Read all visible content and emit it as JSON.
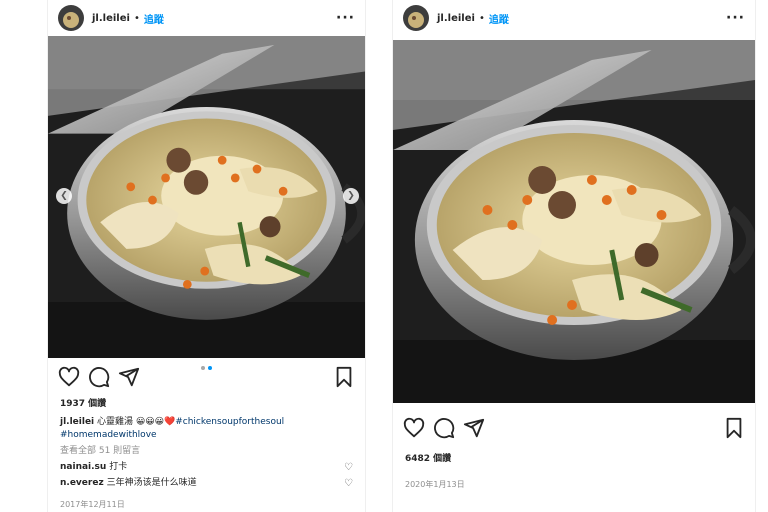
{
  "left_post": {
    "username": "jl.leilei",
    "dot": "•",
    "follow": "追蹤",
    "more": "···",
    "likes": "1937 個讚",
    "caption_text": "心靈雞湯 😀😀😀❤️",
    "caption_tag1": "#chickensoupforthesoul",
    "caption_tag2": "#homemadewithlove",
    "view_comments": "查看全部 51 則留言",
    "comments": [
      {
        "user": "nainai.su",
        "text": "打卡"
      },
      {
        "user": "n.everez",
        "text": "三年神汤该是什么味道"
      }
    ],
    "date": "2017年12月11日"
  },
  "right_post": {
    "username": "jl.leilei",
    "dot": "•",
    "follow": "追蹤",
    "more": "···",
    "likes": "6482 個讚",
    "date": "2020年1月13日"
  },
  "icons": {
    "like": "heart-icon",
    "comment": "comment-icon",
    "share": "share-icon",
    "save": "bookmark-icon"
  },
  "colors": {
    "link": "#0095f6",
    "hashtag": "#00376b",
    "muted": "#8e8e8e"
  }
}
